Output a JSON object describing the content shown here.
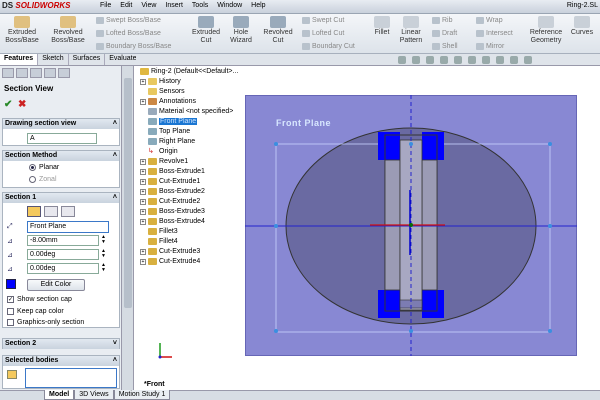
{
  "app": {
    "logo": "SOLIDWORKS",
    "logo_prefix": "DS",
    "doc_title": "Ring-2.SL"
  },
  "menu": [
    "File",
    "Edit",
    "View",
    "Insert",
    "Tools",
    "Window",
    "Help"
  ],
  "ribbon": {
    "extruded_boss": "Extruded Boss/Base",
    "revolved_boss": "Revolved Boss/Base",
    "swept_boss": "Swept Boss/Base",
    "lofted_boss": "Lofted Boss/Base",
    "boundary_boss": "Boundary Boss/Base",
    "extruded_cut": "Extruded Cut",
    "hole_wizard": "Hole Wizard",
    "revolved_cut": "Revolved Cut",
    "swept_cut": "Swept Cut",
    "lofted_cut": "Lofted Cut",
    "boundary_cut": "Boundary Cut",
    "fillet": "Fillet",
    "linear_pattern": "Linear Pattern",
    "rib": "Rib",
    "draft": "Draft",
    "shell": "Shell",
    "wrap": "Wrap",
    "intersect": "Intersect",
    "mirror": "Mirror",
    "reference_geometry": "Reference Geometry",
    "curves": "Curves"
  },
  "tabs": [
    "Features",
    "Sketch",
    "Surfaces",
    "Evaluate"
  ],
  "section_view": {
    "title": "Section View",
    "drawing_group": "Drawing section view",
    "drawing_value": "A",
    "method_group": "Section Method",
    "planar": "Planar",
    "zonal": "Zonal",
    "section1_group": "Section 1",
    "plane_value": "Front Plane",
    "offset_value": "-8.00mm",
    "angle1_value": "0.00deg",
    "angle2_value": "0.00deg",
    "edit_color": "Edit Color",
    "show_cap": "Show section cap",
    "keep_cap_color": "Keep cap color",
    "graphics_only": "Graphics-only section",
    "section2_group": "Section 2",
    "selected_bodies_group": "Selected bodies"
  },
  "tree": [
    {
      "label": "Ring-2  (Default<<Default>...",
      "icon": "part",
      "expand": false
    },
    {
      "label": "History",
      "icon": "folder",
      "expand": true
    },
    {
      "label": "Sensors",
      "icon": "folder",
      "expand": false
    },
    {
      "label": "Annotations",
      "icon": "annot",
      "expand": true
    },
    {
      "label": "Material <not specified>",
      "icon": "material",
      "expand": false
    },
    {
      "label": "Front Plane",
      "icon": "plane-sel",
      "expand": false
    },
    {
      "label": "Top Plane",
      "icon": "plane",
      "expand": false
    },
    {
      "label": "Right Plane",
      "icon": "plane",
      "expand": false
    },
    {
      "label": "Origin",
      "icon": "origin",
      "expand": false
    },
    {
      "label": "Revolve1",
      "icon": "feature",
      "expand": true
    },
    {
      "label": "Boss-Extrude1",
      "icon": "feature",
      "expand": true
    },
    {
      "label": "Cut-Extrude1",
      "icon": "feature",
      "expand": true
    },
    {
      "label": "Boss-Extrude2",
      "icon": "feature",
      "expand": true
    },
    {
      "label": "Cut-Extrude2",
      "icon": "feature",
      "expand": true
    },
    {
      "label": "Boss-Extrude3",
      "icon": "feature",
      "expand": true
    },
    {
      "label": "Boss-Extrude4",
      "icon": "feature",
      "expand": true
    },
    {
      "label": "Fillet3",
      "icon": "fillet",
      "expand": false
    },
    {
      "label": "Fillet4",
      "icon": "fillet",
      "expand": false
    },
    {
      "label": "Cut-Extrude3",
      "icon": "feature",
      "expand": true
    },
    {
      "label": "Cut-Extrude4",
      "icon": "feature",
      "expand": true
    }
  ],
  "viewport": {
    "plane_label": "Front Plane",
    "view_name": "*Front"
  },
  "bottom_tabs": [
    "Model",
    "3D Views",
    "Motion Study 1"
  ],
  "colors": {
    "plane": "#8888d3",
    "section_cap": "#0000ff",
    "ring_body": "#6a6aa2",
    "selected": "#1a76d2"
  }
}
